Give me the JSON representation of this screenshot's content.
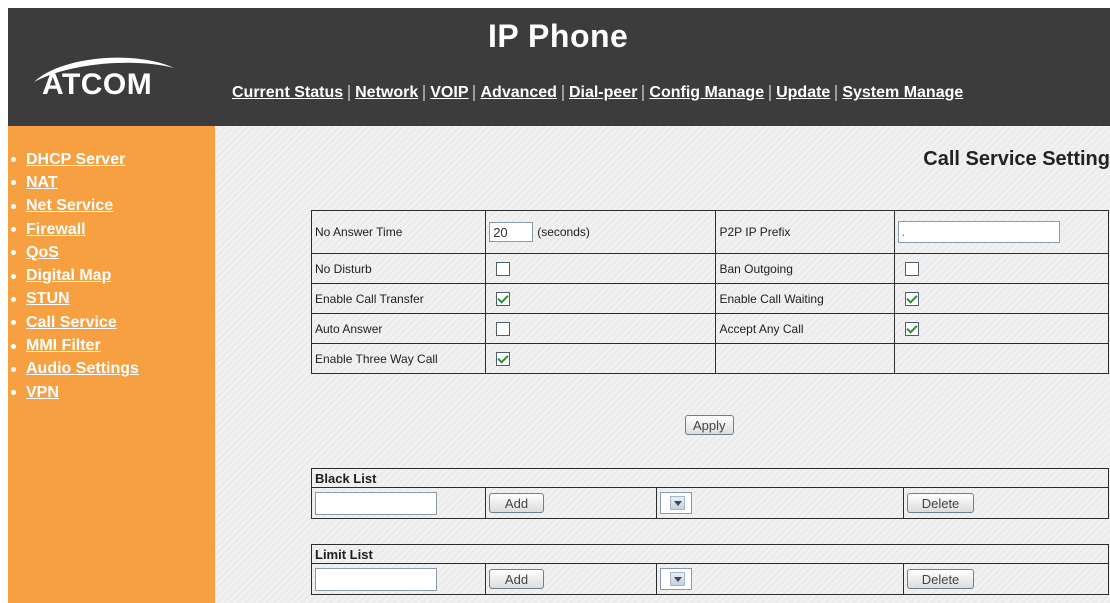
{
  "header": {
    "title": "IP Phone",
    "logo_text": "ATCOM",
    "nav": [
      "Current Status",
      "Network",
      "VOIP",
      "Advanced",
      "Dial-peer",
      "Config Manage",
      "Update",
      "System Manage"
    ]
  },
  "sidebar": {
    "items": [
      "DHCP Server",
      "NAT",
      "Net Service",
      "Firewall",
      "QoS",
      "Digital Map",
      "STUN",
      "Call Service",
      "MMI Filter",
      "Audio Settings",
      "VPN"
    ]
  },
  "main": {
    "heading": "Call Service Setting",
    "settings": {
      "no_answer_time_label": "No Answer Time",
      "no_answer_time_value": "20",
      "no_answer_time_unit": "(seconds)",
      "p2p_ip_prefix_label": "P2P IP Prefix",
      "p2p_ip_prefix_value": ".",
      "no_disturb_label": "No Disturb",
      "no_disturb_checked": false,
      "ban_outgoing_label": "Ban Outgoing",
      "ban_outgoing_checked": false,
      "enable_call_transfer_label": "Enable Call Transfer",
      "enable_call_transfer_checked": true,
      "enable_call_waiting_label": "Enable Call Waiting",
      "enable_call_waiting_checked": true,
      "auto_answer_label": "Auto Answer",
      "auto_answer_checked": false,
      "accept_any_call_label": "Accept Any Call",
      "accept_any_call_checked": true,
      "enable_three_way_call_label": "Enable Three Way Call",
      "enable_three_way_call_checked": true
    },
    "apply_label": "Apply",
    "black_list": {
      "title": "Black List",
      "add_label": "Add",
      "delete_label": "Delete"
    },
    "limit_list": {
      "title": "Limit List",
      "add_label": "Add",
      "delete_label": "Delete"
    }
  },
  "colors": {
    "header_bg": "#3c3c3c",
    "sidebar_bg": "#f6a042",
    "content_bg": "#ececec",
    "check_color": "#2f8f2f"
  },
  "icons": [
    "logo-swoosh-icon",
    "sidebar-bullet-icon",
    "checkbox-check-icon",
    "dropdown-arrow-icon"
  ]
}
